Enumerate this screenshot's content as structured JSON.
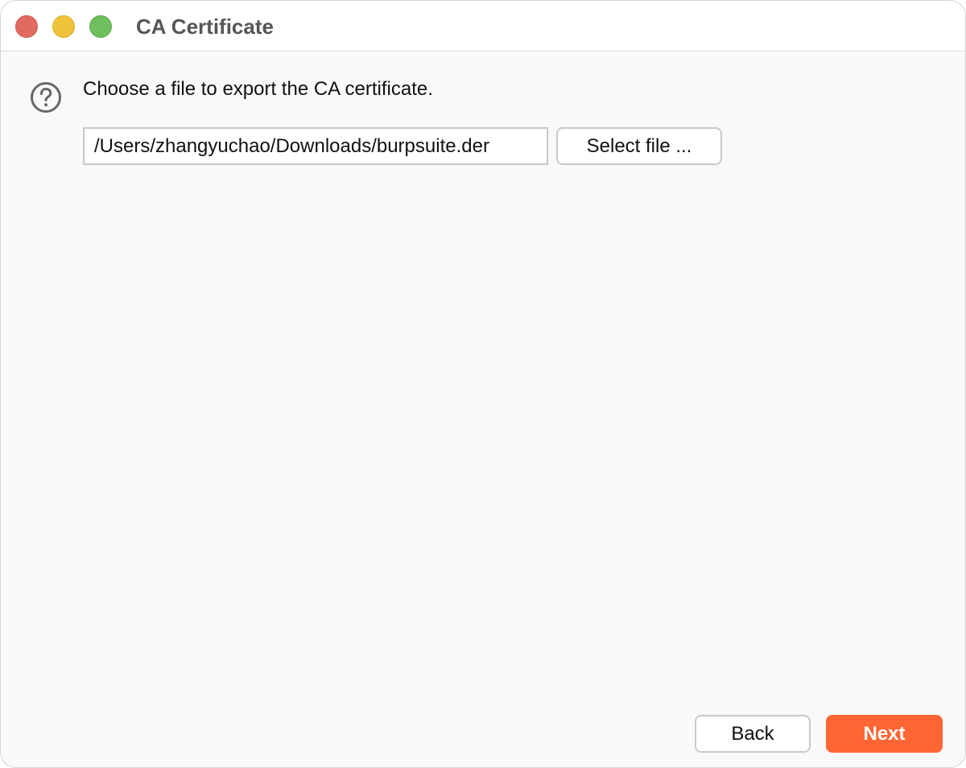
{
  "window": {
    "title": "CA Certificate",
    "controls": [
      "close",
      "minimize",
      "zoom"
    ]
  },
  "content": {
    "icon": "question-circle-icon",
    "prompt": "Choose a file to export the CA certificate.",
    "file_path": "/Users/zhangyuchao/Downloads/burpsuite.der",
    "select_file_label": "Select file ..."
  },
  "footer": {
    "back_label": "Back",
    "next_label": "Next"
  },
  "colors": {
    "accent": "#ff6633",
    "close": "#e16b61",
    "minimize": "#efc33a",
    "zoom": "#6fbf5f"
  }
}
